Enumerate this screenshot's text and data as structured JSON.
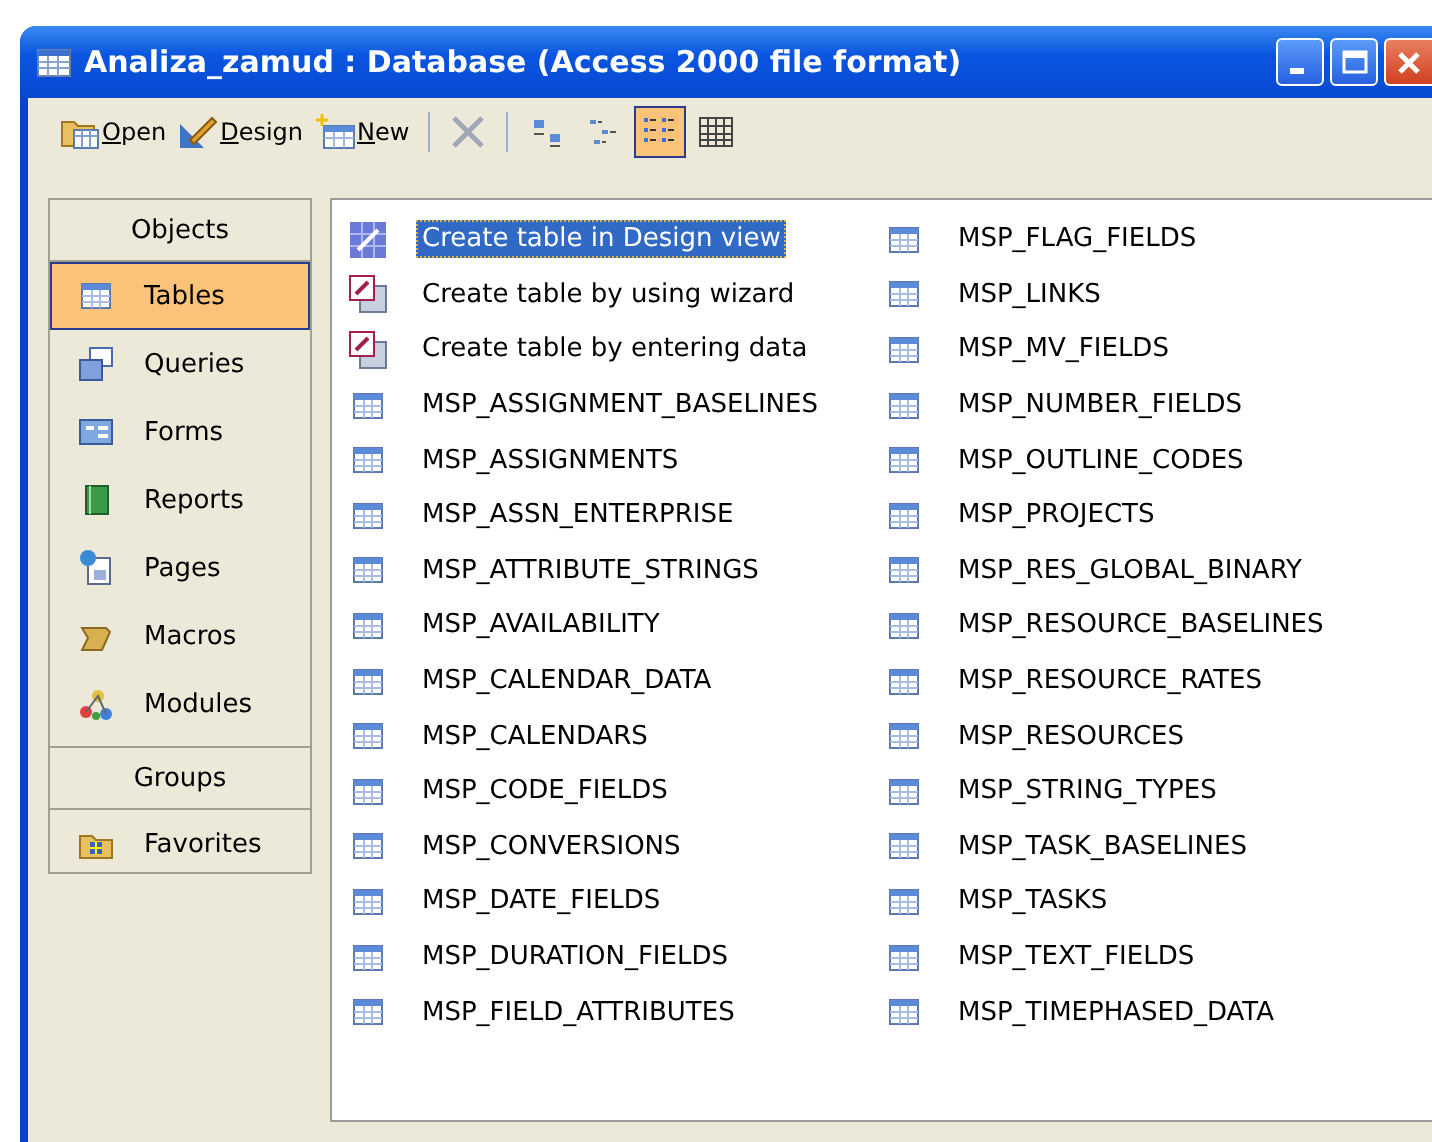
{
  "window": {
    "title": "Analiza_zamud : Database (Access 2000 file format)"
  },
  "toolbar": {
    "commands": [
      {
        "label": "Open",
        "kind": "open"
      },
      {
        "label": "Design",
        "kind": "design"
      },
      {
        "label": "New",
        "kind": "new"
      }
    ],
    "views": [
      {
        "kind": "large",
        "selected": false
      },
      {
        "kind": "small",
        "selected": false
      },
      {
        "kind": "list",
        "selected": true
      },
      {
        "kind": "details",
        "selected": false
      }
    ]
  },
  "objects": {
    "header": "Objects",
    "items": [
      {
        "label": "Tables",
        "kind": "tables",
        "selected": true
      },
      {
        "label": "Queries",
        "kind": "queries",
        "selected": false
      },
      {
        "label": "Forms",
        "kind": "forms",
        "selected": false
      },
      {
        "label": "Reports",
        "kind": "reports",
        "selected": false
      },
      {
        "label": "Pages",
        "kind": "pages",
        "selected": false
      },
      {
        "label": "Macros",
        "kind": "macros",
        "selected": false
      },
      {
        "label": "Modules",
        "kind": "modules",
        "selected": false
      }
    ]
  },
  "groups": {
    "header": "Groups",
    "items": [
      {
        "label": "Favorites",
        "selected": false
      }
    ]
  },
  "list": [
    {
      "label": "Create table in Design view",
      "kind": "design",
      "selected": true
    },
    {
      "label": "Create table by using wizard",
      "kind": "wizard",
      "selected": false
    },
    {
      "label": "Create table by entering data",
      "kind": "wizard",
      "selected": false
    },
    {
      "label": "MSP_ASSIGNMENT_BASELINES",
      "kind": "table",
      "selected": false
    },
    {
      "label": "MSP_ASSIGNMENTS",
      "kind": "table",
      "selected": false
    },
    {
      "label": "MSP_ASSN_ENTERPRISE",
      "kind": "table",
      "selected": false
    },
    {
      "label": "MSP_ATTRIBUTE_STRINGS",
      "kind": "table",
      "selected": false
    },
    {
      "label": "MSP_AVAILABILITY",
      "kind": "table",
      "selected": false
    },
    {
      "label": "MSP_CALENDAR_DATA",
      "kind": "table",
      "selected": false
    },
    {
      "label": "MSP_CALENDARS",
      "kind": "table",
      "selected": false
    },
    {
      "label": "MSP_CODE_FIELDS",
      "kind": "table",
      "selected": false
    },
    {
      "label": "MSP_CONVERSIONS",
      "kind": "table",
      "selected": false
    },
    {
      "label": "MSP_DATE_FIELDS",
      "kind": "table",
      "selected": false
    },
    {
      "label": "MSP_DURATION_FIELDS",
      "kind": "table",
      "selected": false
    },
    {
      "label": "MSP_FIELD_ATTRIBUTES",
      "kind": "table",
      "selected": false
    },
    {
      "label": "MSP_FLAG_FIELDS",
      "kind": "table",
      "selected": false
    },
    {
      "label": "MSP_LINKS",
      "kind": "table",
      "selected": false
    },
    {
      "label": "MSP_MV_FIELDS",
      "kind": "table",
      "selected": false
    },
    {
      "label": "MSP_NUMBER_FIELDS",
      "kind": "table",
      "selected": false
    },
    {
      "label": "MSP_OUTLINE_CODES",
      "kind": "table",
      "selected": false
    },
    {
      "label": "MSP_PROJECTS",
      "kind": "table",
      "selected": false
    },
    {
      "label": "MSP_RES_GLOBAL_BINARY",
      "kind": "table",
      "selected": false
    },
    {
      "label": "MSP_RESOURCE_BASELINES",
      "kind": "table",
      "selected": false
    },
    {
      "label": "MSP_RESOURCE_RATES",
      "kind": "table",
      "selected": false
    },
    {
      "label": "MSP_RESOURCES",
      "kind": "table",
      "selected": false
    },
    {
      "label": "MSP_STRING_TYPES",
      "kind": "table",
      "selected": false
    },
    {
      "label": "MSP_TASK_BASELINES",
      "kind": "table",
      "selected": false
    },
    {
      "label": "MSP_TASKS",
      "kind": "table",
      "selected": false
    },
    {
      "label": "MSP_TEXT_FIELDS",
      "kind": "table",
      "selected": false
    },
    {
      "label": "MSP_TIMEPHASED_DATA",
      "kind": "table",
      "selected": false
    }
  ]
}
